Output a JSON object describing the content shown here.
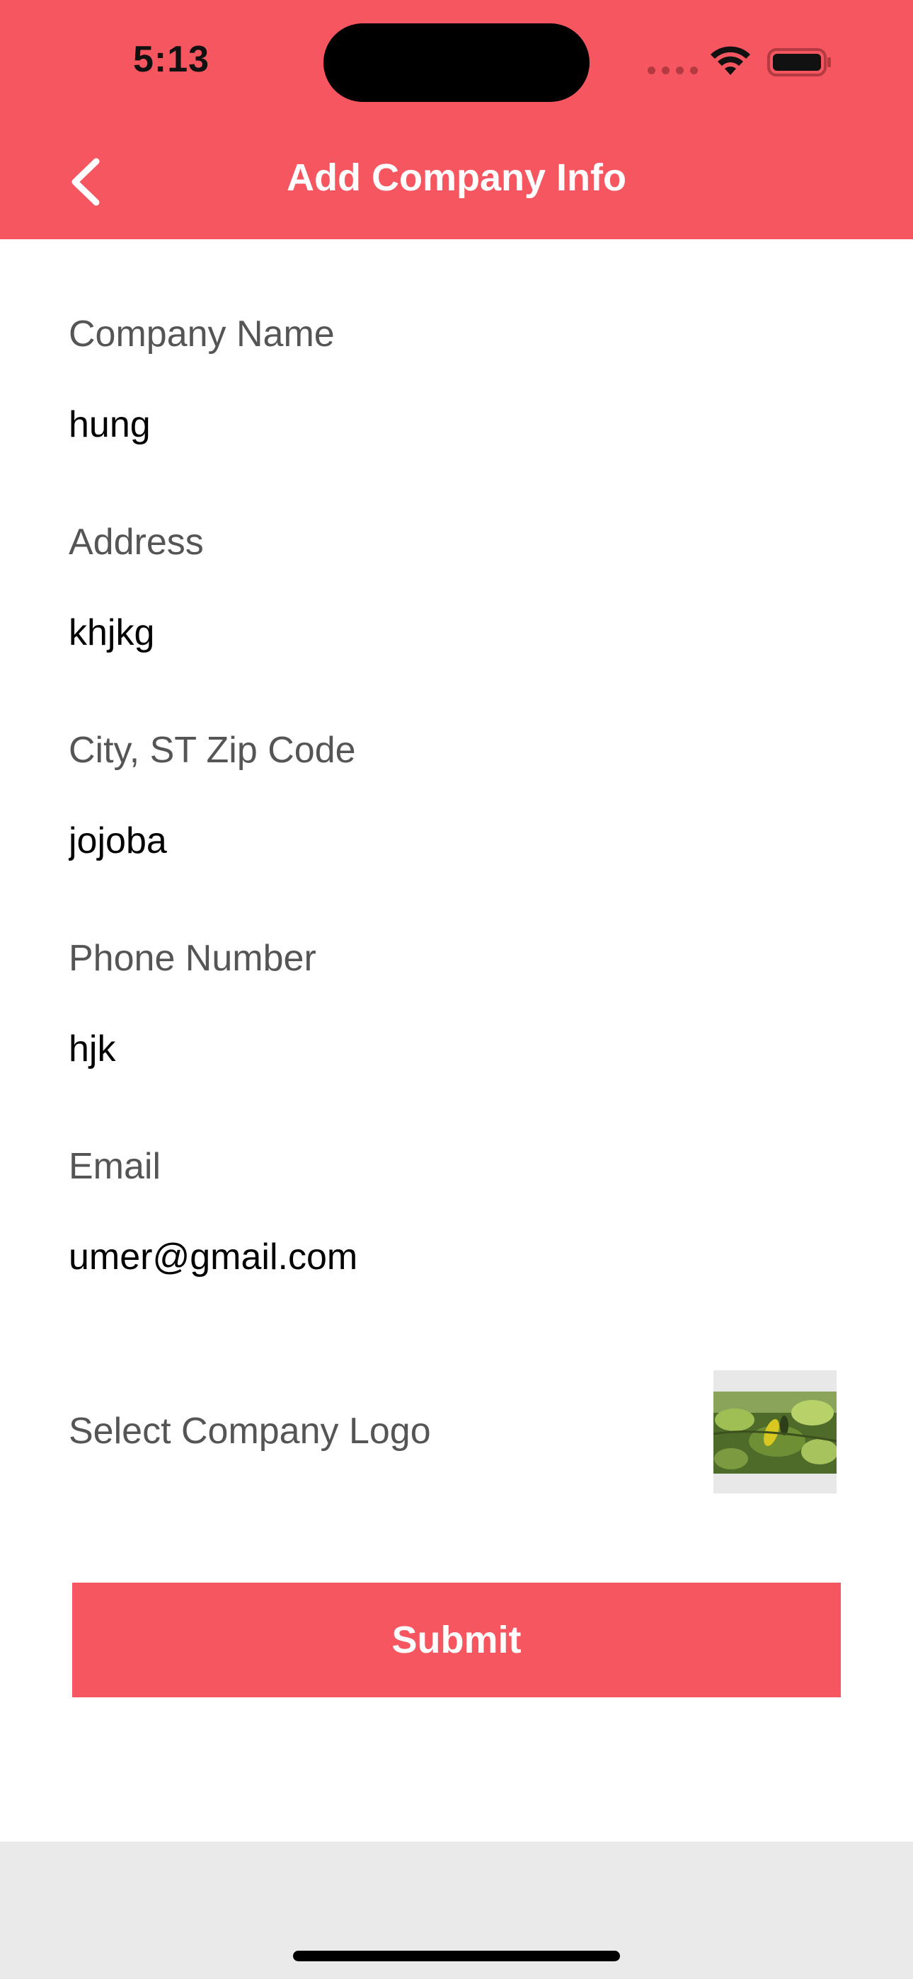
{
  "status_bar": {
    "time": "5:13"
  },
  "nav": {
    "title": "Add Company Info",
    "back_icon": "chevron-left-icon"
  },
  "form": {
    "fields": [
      {
        "label": "Company Name",
        "value": "hung"
      },
      {
        "label": "Address",
        "value": "khjkg"
      },
      {
        "label": "City, ST Zip Code",
        "value": "jojoba"
      },
      {
        "label": "Phone Number",
        "value": "hjk"
      },
      {
        "label": "Email",
        "value": "umer@gmail.com"
      }
    ],
    "logo_label": "Select Company Logo",
    "submit_label": "Submit"
  },
  "colors": {
    "accent": "#f6565f",
    "label": "#555555",
    "value": "#000000",
    "footer": "#eaeaea"
  }
}
